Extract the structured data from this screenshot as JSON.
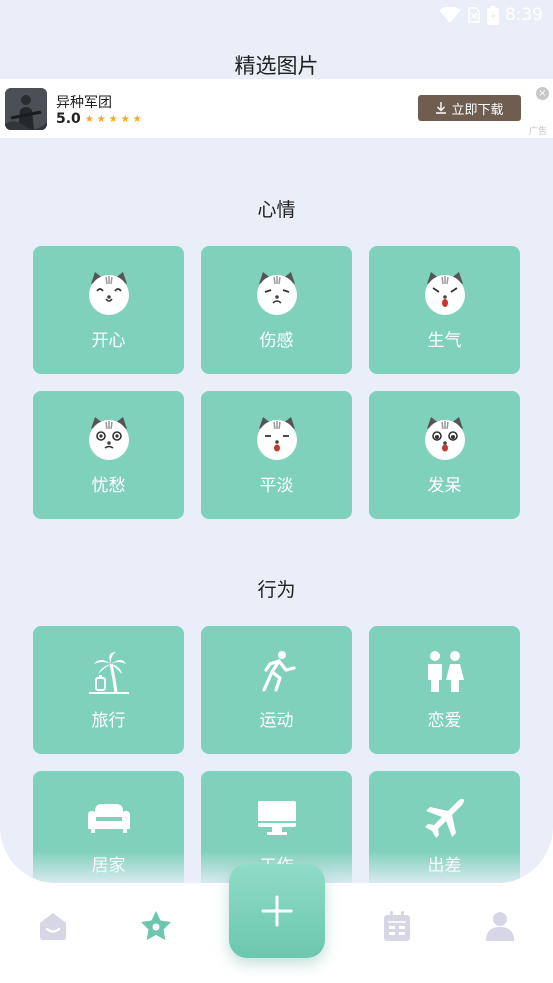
{
  "status_bar": {
    "time": "8:39"
  },
  "page_title": "精选图片",
  "ad": {
    "app_name": "异种军团",
    "rating": "5.0",
    "stars": "★★★★★",
    "download_label": "立即下载",
    "close_symbol": "×",
    "tag": "广告"
  },
  "sections": [
    {
      "title": "心情",
      "items": [
        {
          "label": "开心",
          "icon": "cat-happy-icon"
        },
        {
          "label": "伤感",
          "icon": "cat-sad-icon"
        },
        {
          "label": "生气",
          "icon": "cat-angry-icon"
        },
        {
          "label": "忧愁",
          "icon": "cat-worried-icon"
        },
        {
          "label": "平淡",
          "icon": "cat-calm-icon"
        },
        {
          "label": "发呆",
          "icon": "cat-daze-icon"
        }
      ]
    },
    {
      "title": "行为",
      "items": [
        {
          "label": "旅行",
          "icon": "palm-tree-icon"
        },
        {
          "label": "运动",
          "icon": "running-icon"
        },
        {
          "label": "恋爱",
          "icon": "couple-icon"
        },
        {
          "label": "居家",
          "icon": "sofa-icon"
        },
        {
          "label": "工作",
          "icon": "monitor-icon"
        },
        {
          "label": "出差",
          "icon": "airplane-icon"
        }
      ]
    }
  ],
  "bottom_nav": {
    "items": [
      "home-icon",
      "star-icon",
      "add-icon",
      "calendar-icon",
      "profile-icon"
    ],
    "active": "star-icon"
  },
  "colors": {
    "tile": "#80d1bb",
    "background": "#e9eef8",
    "nav_active": "#6cc7ae",
    "nav_inactive": "#d6d6e6",
    "download_button": "#6f5d50"
  }
}
